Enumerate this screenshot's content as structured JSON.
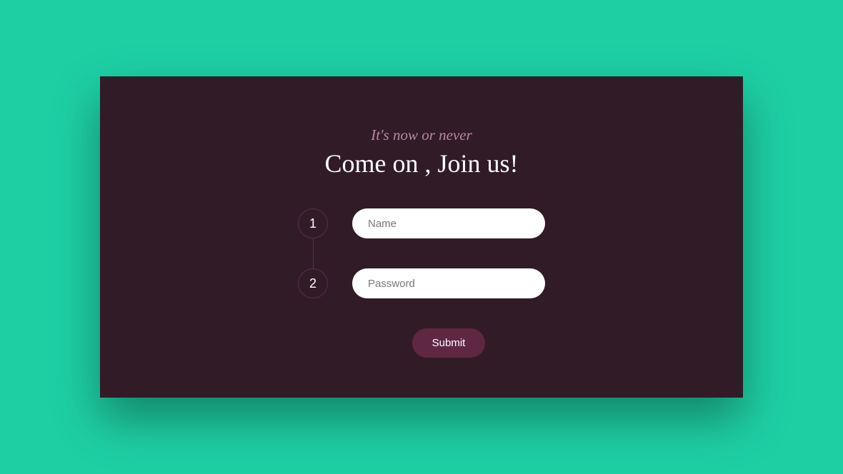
{
  "card": {
    "subtitle": "It's now or never",
    "title": "Come on , Join us!"
  },
  "form": {
    "steps": {
      "one": "1",
      "two": "2"
    },
    "name": {
      "placeholder": "Name",
      "value": ""
    },
    "password": {
      "placeholder": "Password",
      "value": ""
    },
    "submit_label": "Submit"
  }
}
